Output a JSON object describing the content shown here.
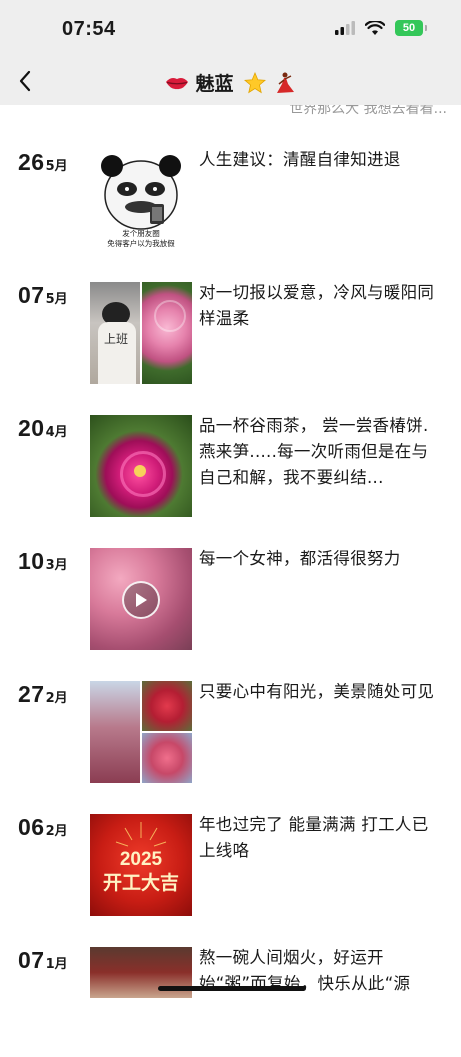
{
  "status_bar": {
    "time": "07:54",
    "battery": "50"
  },
  "nav": {
    "title": "魅蓝",
    "subtitle": "世界那么大 我想去看看..."
  },
  "colors": {
    "battery_green": "#34c759",
    "muted_text": "#999999"
  },
  "posts": [
    {
      "day": "26",
      "month": "5月",
      "text": "人生建议：清醒自律知进退",
      "image": "panda-meme",
      "image_caption": "发个朋友圈\n免得客户以为我放假"
    },
    {
      "day": "07",
      "month": "5月",
      "text": "对一切报以爱意，冷风与暖阳同样温柔",
      "image": "work-and-rose",
      "image_caption": "上班"
    },
    {
      "day": "20",
      "month": "4月",
      "text": "品一杯谷雨茶， 尝一尝香椿饼. 燕来笋.....每一次听雨但是在与自己和解，我不要纠结...",
      "image": "peony-flower"
    },
    {
      "day": "10",
      "month": "3月",
      "text": "每一个女神，都活得很努力",
      "image": "cherry-blossom-video"
    },
    {
      "day": "27",
      "month": "2月",
      "text": "只要心中有阳光，美景随处可见",
      "image": "plum-blossom-collage"
    },
    {
      "day": "06",
      "month": "2月",
      "text": "年也过完了 能量满满 打工人已上线咯",
      "image": "new-year-poster",
      "image_caption": "2025\n开工大吉"
    },
    {
      "day": "07",
      "month": "1月",
      "text": "熬一碗人间烟火，好运开始“粥”而复始，快乐从此“源",
      "image": "porridge"
    }
  ]
}
